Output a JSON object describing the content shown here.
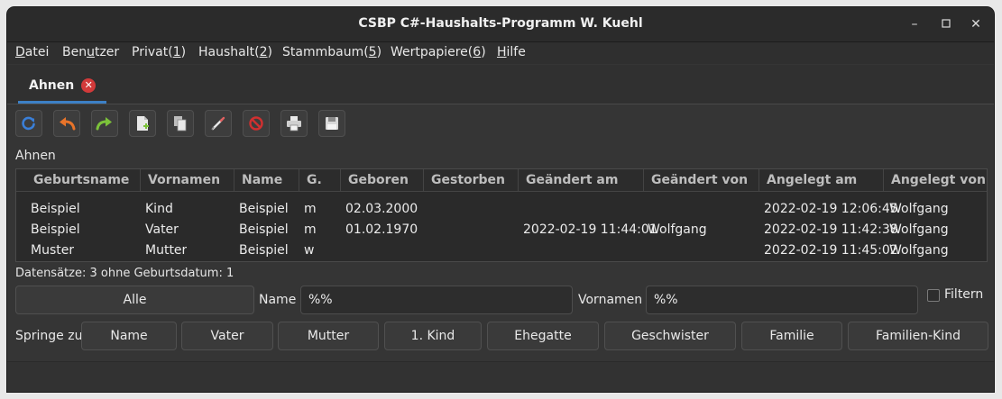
{
  "window": {
    "title": "CSBP C#-Haushalts-Programm W. Kuehl",
    "minimize_icon": "minimize-icon",
    "maximize_icon": "maximize-icon",
    "close_icon": "close-icon"
  },
  "menu": {
    "items": [
      {
        "pre": "",
        "key": "D",
        "post": "atei"
      },
      {
        "pre": "Ben",
        "key": "u",
        "post": "tzer"
      },
      {
        "pre": "Privat(",
        "key": "1",
        "post": ")"
      },
      {
        "pre": "Haushalt(",
        "key": "2",
        "post": ")"
      },
      {
        "pre": "Stammbaum(",
        "key": "5",
        "post": ")"
      },
      {
        "pre": "Wertpapiere(",
        "key": "6",
        "post": ")"
      },
      {
        "pre": "",
        "key": "H",
        "post": "ilfe"
      }
    ]
  },
  "tab": {
    "label": "Ahnen",
    "close_glyph": "✕"
  },
  "toolbar": {
    "buttons": [
      "refresh-icon",
      "undo-icon",
      "redo-icon",
      "new-document-icon",
      "copy-icon",
      "edit-icon",
      "delete-icon",
      "print-icon",
      "save-icon"
    ],
    "colors": {
      "refresh": "#3a7fd8",
      "undo": "#e8742a",
      "redo": "#7cc23a",
      "delete": "#d03030"
    }
  },
  "section_label": "Ahnen",
  "table": {
    "columns": [
      "Geburtsname",
      "Vornamen",
      "Name",
      "G.",
      "Geboren",
      "Gestorben",
      "Geändert am",
      "Geändert von",
      "Angelegt am",
      "Angelegt von"
    ],
    "rows": [
      [
        "Beispiel",
        "Kind",
        "Beispiel",
        "m",
        "02.03.2000",
        "",
        "",
        "",
        "2022-02-19 12:06:45",
        "Wolfgang"
      ],
      [
        "Beispiel",
        "Vater",
        "Beispiel",
        "m",
        "01.02.1970",
        "",
        "2022-02-19 11:44:01",
        "Wolfgang",
        "2022-02-19 11:42:38",
        "Wolfgang"
      ],
      [
        "Muster",
        "Mutter",
        "Beispiel",
        "w",
        "",
        "",
        "",
        "",
        "2022-02-19 11:45:02",
        "Wolfgang"
      ]
    ]
  },
  "status": "Datensätze: 3  ohne Geburtsdatum: 1",
  "filter": {
    "all_button": "Alle",
    "name_label": "Name",
    "name_value": "%%",
    "vornamen_label": "Vornamen",
    "vornamen_value": "%%",
    "filter_label": "Filtern"
  },
  "jump": {
    "label": "Springe zu",
    "buttons": [
      "Name",
      "Vater",
      "Mutter",
      "1. Kind",
      "Ehegatte",
      "Geschwister",
      "Familie",
      "Familien-Kind"
    ]
  }
}
